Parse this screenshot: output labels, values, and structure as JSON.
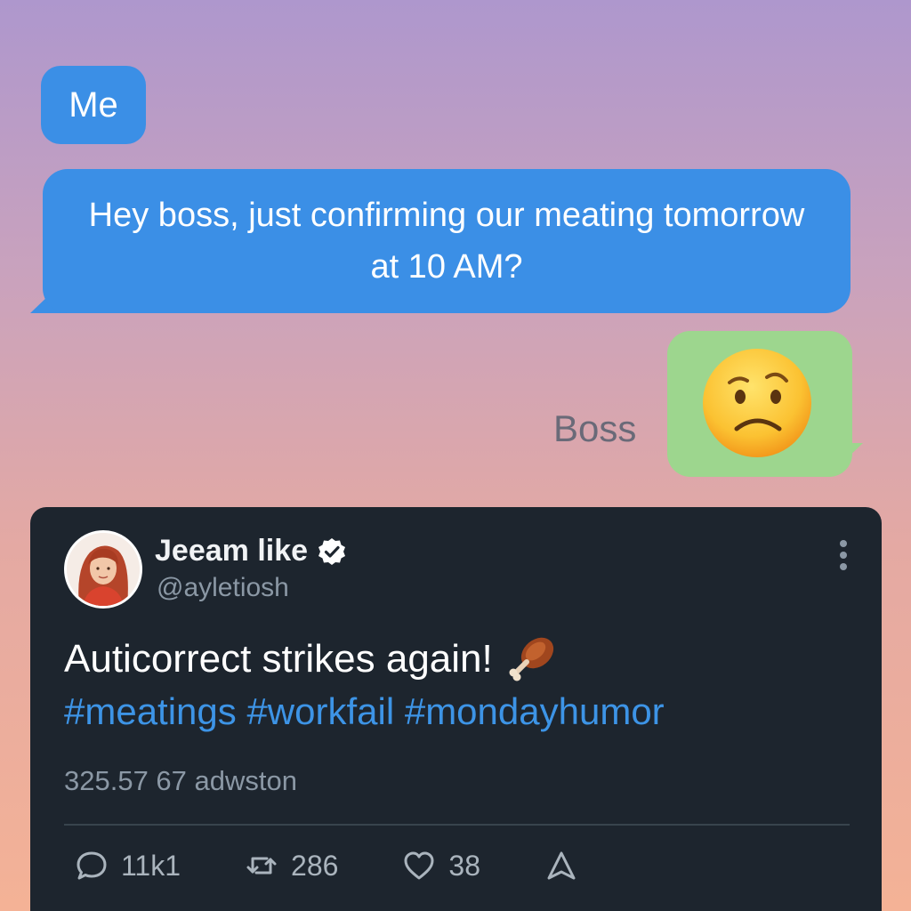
{
  "chat": {
    "sender_label": "Me",
    "me_message": "Hey boss, just confirming our meating tomorrow at 10 AM?",
    "boss_label": "Boss",
    "boss_reply_icon": "confused-face-emoji",
    "colors": {
      "me_bubble": "#3b8fe6",
      "boss_bubble": "#9dd68e"
    }
  },
  "tweet": {
    "display_name": "Jeeam like",
    "verified": true,
    "handle": "@ayletiosh",
    "text": "Auticorrect strikes again!",
    "text_emoji": "poultry-leg-emoji",
    "hashtags": "#meatings #workfail #mondayhumor",
    "stats_line": "325.57 67 adwston",
    "actions": {
      "replies": "11k1",
      "retweets": "286",
      "likes": "38"
    },
    "colors": {
      "card_bg": "#1d252e",
      "hashtag": "#3d94e6"
    }
  }
}
